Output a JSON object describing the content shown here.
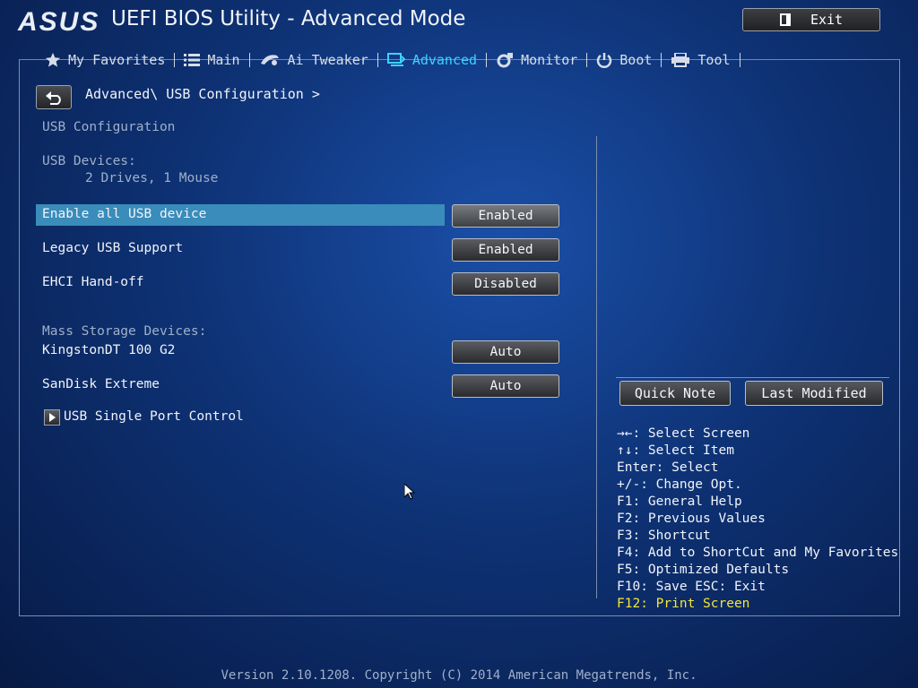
{
  "header": {
    "logo": "ASUS",
    "title": "UEFI BIOS Utility - Advanced Mode",
    "exit_label": "Exit"
  },
  "nav": {
    "tabs": [
      {
        "label": "My Favorites",
        "icon": "star-icon"
      },
      {
        "label": "Main",
        "icon": "list-icon"
      },
      {
        "label": "Ai Tweaker",
        "icon": "tweaker-icon"
      },
      {
        "label": "Advanced",
        "icon": "advanced-icon",
        "active": true
      },
      {
        "label": "Monitor",
        "icon": "monitor-icon"
      },
      {
        "label": "Boot",
        "icon": "power-icon"
      },
      {
        "label": "Tool",
        "icon": "printer-icon"
      }
    ]
  },
  "breadcrumb": "Advanced\\ USB Configuration >",
  "main": {
    "section_title": "USB Configuration",
    "usb_devices_label": "USB Devices:",
    "usb_devices_value": "2 Drives, 1 Mouse",
    "settings": [
      {
        "label": "Enable all USB device",
        "value": "Enabled",
        "selected": true
      },
      {
        "label": "Legacy USB Support",
        "value": "Enabled"
      },
      {
        "label": "EHCI Hand-off",
        "value": "Disabled"
      }
    ],
    "mass_storage_label": "Mass Storage Devices:",
    "storage": [
      {
        "label": "KingstonDT 100 G2",
        "value": "Auto"
      },
      {
        "label": "SanDisk Extreme",
        "value": "Auto"
      }
    ],
    "submenu": "USB Single Port Control"
  },
  "right": {
    "quick_note": "Quick Note",
    "last_modified": "Last Modified",
    "help": [
      "→←: Select Screen",
      "↑↓: Select Item",
      "Enter: Select",
      "+/-: Change Opt.",
      "F1: General Help",
      "F2: Previous Values",
      "F3: Shortcut",
      "F4: Add to ShortCut and My Favorites",
      "F5: Optimized Defaults",
      "F10: Save  ESC: Exit",
      "F12: Print Screen"
    ],
    "accent_color": "#f5e63a"
  },
  "footer": "Version 2.10.1208. Copyright (C) 2014 American Megatrends, Inc."
}
